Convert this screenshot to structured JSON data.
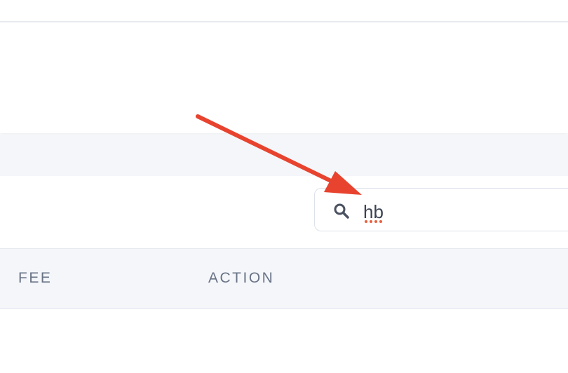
{
  "search": {
    "value": "hb",
    "icon": "search-icon"
  },
  "table": {
    "columns": [
      {
        "label": "FEE"
      },
      {
        "label": "ACTION"
      }
    ]
  },
  "annotation": {
    "arrow_color": "#e8432f"
  },
  "colors": {
    "band": "#f4f6fa",
    "header_text": "#697386",
    "border": "#dde2ea"
  }
}
